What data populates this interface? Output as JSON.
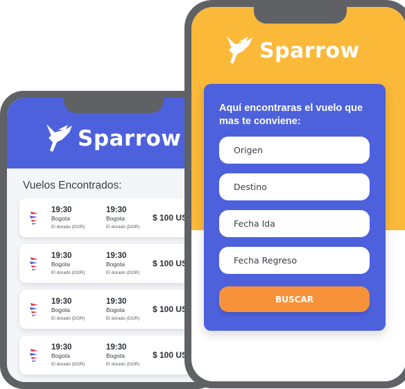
{
  "brand": {
    "name": "Sparrow"
  },
  "results": {
    "title": "Vuelos Encontrados:",
    "flights": [
      {
        "depart_time": "19:30",
        "depart_city": "Bogota",
        "depart_airport": "El dorado (DOR)",
        "arrive_time": "19:30",
        "arrive_city": "Bogota",
        "arrive_airport": "El dorado (DOR)",
        "price": "$ 100 US"
      },
      {
        "depart_time": "19:30",
        "depart_city": "Bogota",
        "depart_airport": "El dorado (DOR)",
        "arrive_time": "19:30",
        "arrive_city": "Bogota",
        "arrive_airport": "El dorado (DOR)",
        "price": "$ 100 US"
      },
      {
        "depart_time": "19:30",
        "depart_city": "Bogota",
        "depart_airport": "El dorado (DOR)",
        "arrive_time": "19:30",
        "arrive_city": "Bogota",
        "arrive_airport": "El dorado (DOR)",
        "price": "$ 100 US"
      },
      {
        "depart_time": "19:30",
        "depart_city": "Bogota",
        "depart_airport": "El dorado (DOR)",
        "arrive_time": "19:30",
        "arrive_city": "Bogota",
        "arrive_airport": "El dorado (DOR)",
        "price": "$ 100 US"
      }
    ]
  },
  "search": {
    "title": "Aquí encontraras el vuelo que mas te conviene:",
    "origin_placeholder": "Origen",
    "destination_placeholder": "Destino",
    "depart_date_placeholder": "Fecha Ida",
    "return_date_placeholder": "Fecha Regreso",
    "button_label": "BUSCAR"
  },
  "colors": {
    "primary_blue": "#4d61dd",
    "accent_yellow": "#fbb93a",
    "button_orange": "#f7923a",
    "phone_frame": "#5f6165"
  },
  "icons": {
    "brand": "sparrow-bird-icon",
    "airline": "airline-logo-icon"
  }
}
